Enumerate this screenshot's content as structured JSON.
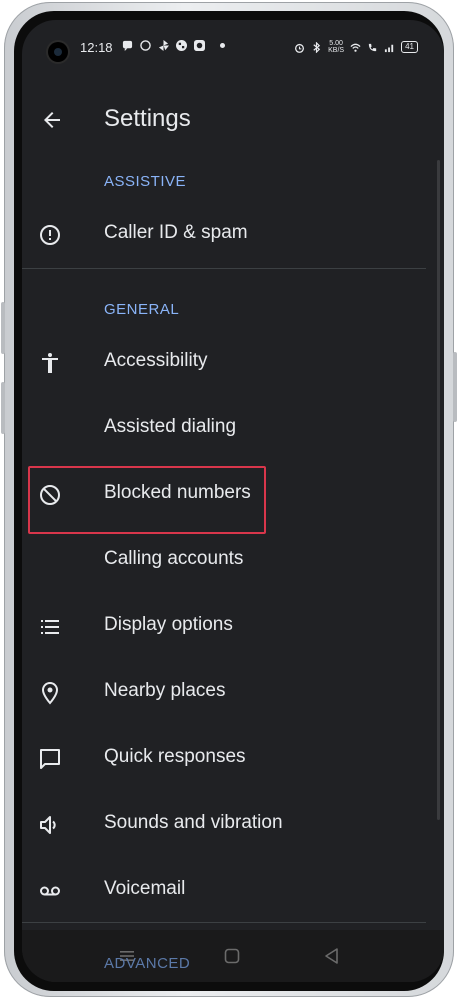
{
  "status_bar": {
    "time": "12:18",
    "net_speed_top": "5.00",
    "net_speed_bottom": "KB/S",
    "battery": "41"
  },
  "app_bar": {
    "title": "Settings",
    "back_icon": "arrow-back-icon"
  },
  "sections": [
    {
      "header": "ASSISTIVE",
      "items": [
        {
          "label": "Caller ID & spam",
          "icon": "alert-circle-icon"
        }
      ]
    },
    {
      "header": "GENERAL",
      "items": [
        {
          "label": "Accessibility",
          "icon": "accessibility-icon"
        },
        {
          "label": "Assisted dialing",
          "icon": ""
        },
        {
          "label": "Blocked numbers",
          "icon": "block-icon"
        },
        {
          "label": "Calling accounts",
          "icon": ""
        },
        {
          "label": "Display options",
          "icon": "list-icon"
        },
        {
          "label": "Nearby places",
          "icon": "location-pin-icon"
        },
        {
          "label": "Quick responses",
          "icon": "message-icon"
        },
        {
          "label": "Sounds and vibration",
          "icon": "volume-icon"
        },
        {
          "label": "Voicemail",
          "icon": "voicemail-icon"
        }
      ]
    },
    {
      "header": "ADVANCED",
      "items": []
    }
  ],
  "highlight_color": "#d8364b",
  "accent_color": "#8ab4f8",
  "background_color": "#202124"
}
